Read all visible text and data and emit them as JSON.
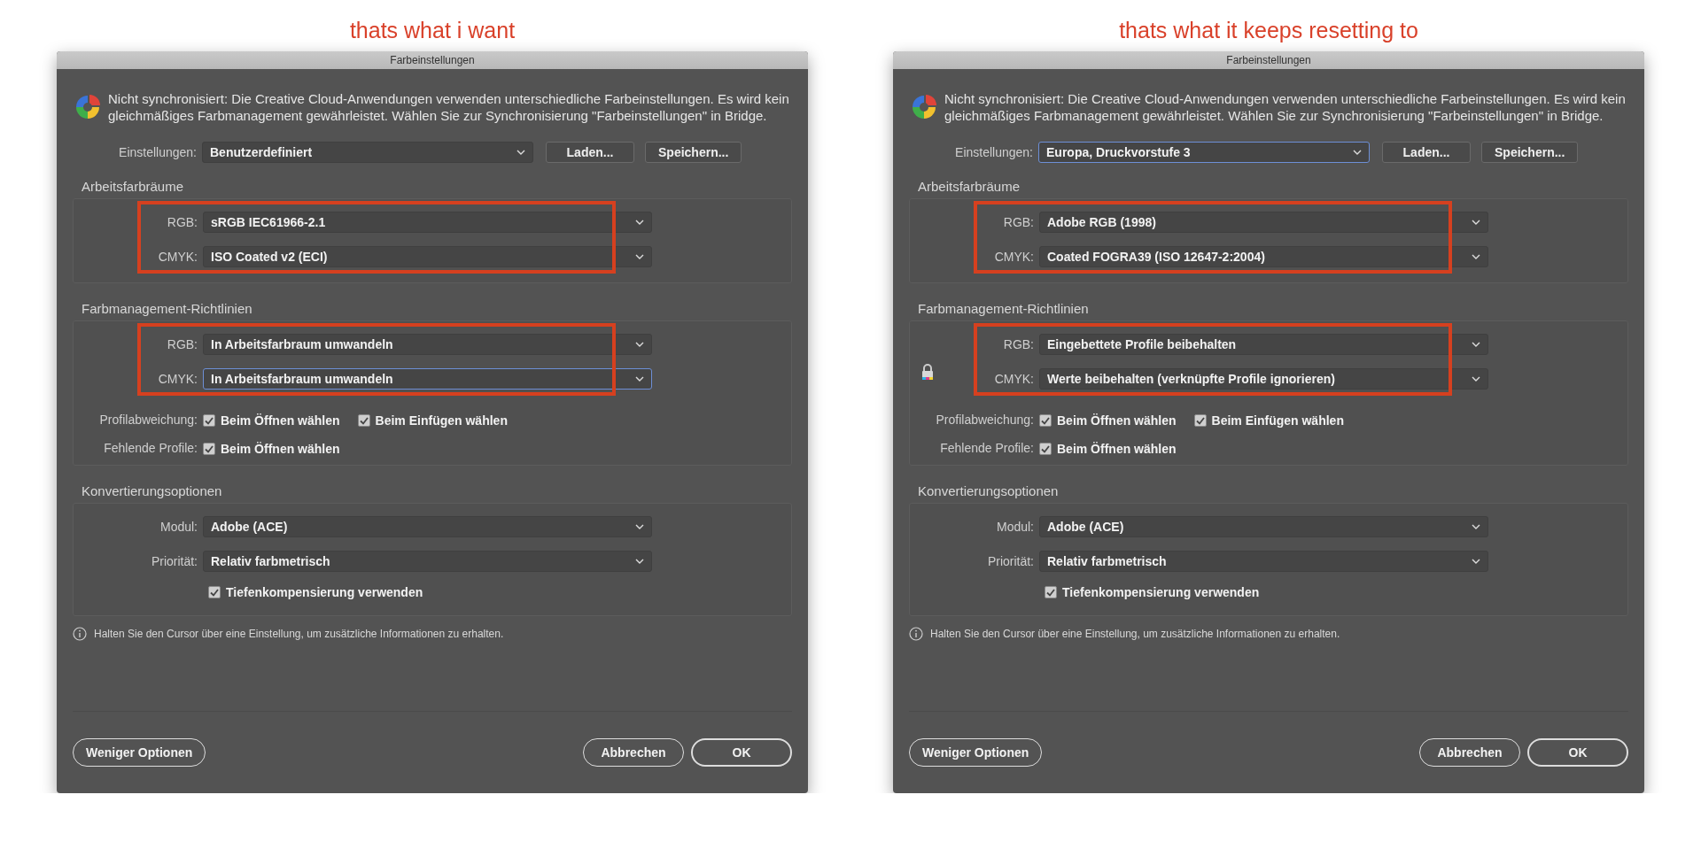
{
  "panels": [
    {
      "caption": "thats what i want",
      "dialog": {
        "title": "Farbeinstellungen",
        "notice": "Nicht synchronisiert: Die Creative Cloud-Anwendungen verwenden unterschiedliche Farbeinstellungen. Es wird kein gleichmäßiges Farbmanagement gewährleistet. Wählen Sie zur Synchronisierung \"Farbeinstellungen\" in Bridge.",
        "settings": {
          "label": "Einstellungen:",
          "value": "Benutzerdefiniert",
          "focused": false
        },
        "load_button": "Laden...",
        "save_button": "Speichern...",
        "working_spaces": {
          "title": "Arbeitsfarbräume",
          "highlighted": true,
          "rows": [
            {
              "label": "RGB:",
              "value": "sRGB IEC61966-2.1",
              "focused": false
            },
            {
              "label": "CMYK:",
              "value": "ISO Coated v2 (ECI)",
              "focused": false
            }
          ]
        },
        "policies": {
          "title": "Farbmanagement-Richtlinien",
          "highlighted": true,
          "locked": false,
          "rows": [
            {
              "label": "RGB:",
              "value": "In Arbeitsfarbraum umwandeln",
              "focused": false
            },
            {
              "label": "CMYK:",
              "value": "In Arbeitsfarbraum umwandeln",
              "focused": true
            }
          ],
          "checks": [
            {
              "label": "Profilabweichung:",
              "options": [
                {
                  "label": "Beim Öffnen wählen",
                  "checked": true
                },
                {
                  "label": "Beim Einfügen wählen",
                  "checked": true
                }
              ]
            },
            {
              "label": "Fehlende Profile:",
              "options": [
                {
                  "label": "Beim Öffnen wählen",
                  "checked": true
                }
              ]
            }
          ]
        },
        "conversion": {
          "title": "Konvertierungsoptionen",
          "rows": [
            {
              "label": "Modul:",
              "value": "Adobe (ACE)",
              "focused": false
            },
            {
              "label": "Priorität:",
              "value": "Relativ farbmetrisch",
              "focused": false
            }
          ],
          "option": {
            "label": "Tiefenkompensierung verwenden",
            "checked": true
          }
        },
        "info": "Halten Sie den Cursor über eine Einstellung, um zusätzliche Informationen zu erhalten.",
        "fewer_button": "Weniger Optionen",
        "cancel_button": "Abbrechen",
        "ok_button": "OK"
      }
    },
    {
      "caption": "thats what it keeps resetting to",
      "dialog": {
        "title": "Farbeinstellungen",
        "notice": "Nicht synchronisiert: Die Creative Cloud-Anwendungen verwenden unterschiedliche Farbeinstellungen. Es wird kein gleichmäßiges Farbmanagement gewährleistet. Wählen Sie zur Synchronisierung \"Farbeinstellungen\" in Bridge.",
        "settings": {
          "label": "Einstellungen:",
          "value": "Europa, Druckvorstufe 3",
          "focused": true
        },
        "load_button": "Laden...",
        "save_button": "Speichern...",
        "working_spaces": {
          "title": "Arbeitsfarbräume",
          "highlighted": true,
          "rows": [
            {
              "label": "RGB:",
              "value": "Adobe RGB (1998)",
              "focused": false
            },
            {
              "label": "CMYK:",
              "value": "Coated FOGRA39 (ISO 12647-2:2004)",
              "focused": false
            }
          ]
        },
        "policies": {
          "title": "Farbmanagement-Richtlinien",
          "highlighted": true,
          "locked": true,
          "rows": [
            {
              "label": "RGB:",
              "value": "Eingebettete Profile beibehalten",
              "focused": false
            },
            {
              "label": "CMYK:",
              "value": "Werte beibehalten (verknüpfte Profile ignorieren)",
              "focused": false
            }
          ],
          "checks": [
            {
              "label": "Profilabweichung:",
              "options": [
                {
                  "label": "Beim Öffnen wählen",
                  "checked": true
                },
                {
                  "label": "Beim Einfügen wählen",
                  "checked": true
                }
              ]
            },
            {
              "label": "Fehlende Profile:",
              "options": [
                {
                  "label": "Beim Öffnen wählen",
                  "checked": true
                }
              ]
            }
          ]
        },
        "conversion": {
          "title": "Konvertierungsoptionen",
          "rows": [
            {
              "label": "Modul:",
              "value": "Adobe (ACE)",
              "focused": false
            },
            {
              "label": "Priorität:",
              "value": "Relativ farbmetrisch",
              "focused": false
            }
          ],
          "option": {
            "label": "Tiefenkompensierung verwenden",
            "checked": true
          }
        },
        "info": "Halten Sie den Cursor über eine Einstellung, um zusätzliche Informationen zu erhalten.",
        "fewer_button": "Weniger Optionen",
        "cancel_button": "Abbrechen",
        "ok_button": "OK"
      }
    }
  ]
}
